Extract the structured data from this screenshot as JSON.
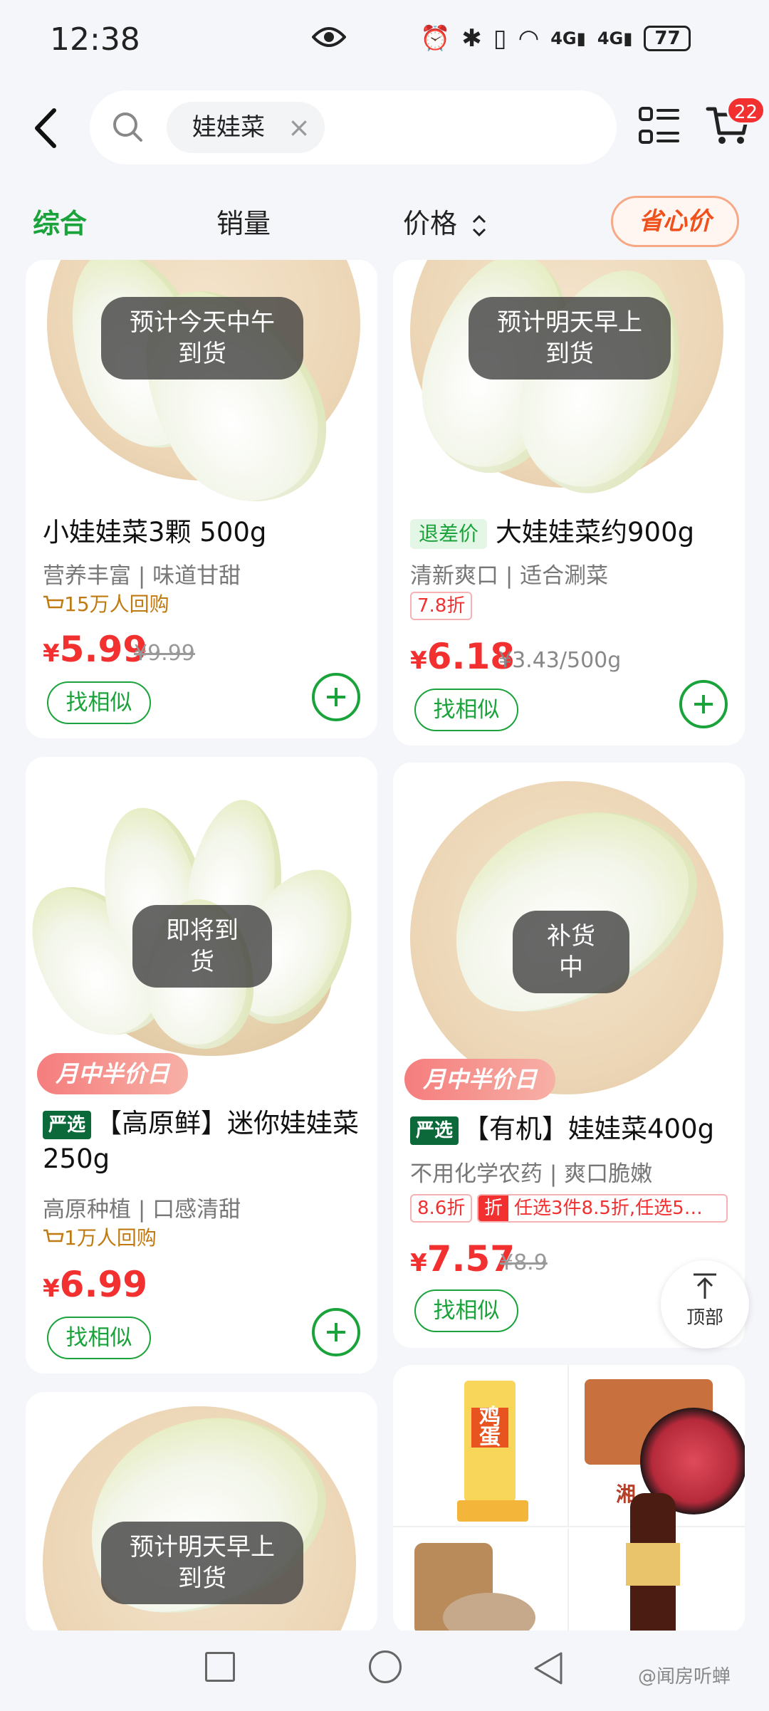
{
  "status_bar": {
    "time": "12:38",
    "battery": "77",
    "icons": [
      "eye-icon",
      "alarm-icon",
      "bluetooth-icon",
      "vibrate-icon",
      "wifi-icon",
      "signal-4g-icon",
      "signal-4g-icon"
    ]
  },
  "header": {
    "search_chip": "娃娃菜",
    "cart_badge": "22"
  },
  "sort_bar": {
    "comprehensive": "综合",
    "sales": "销量",
    "price": "价格",
    "saver_price": "省心价"
  },
  "products": [
    {
      "overlay": "预计今天中午\n到货",
      "title": "小娃娃菜3颗 500g",
      "subtitle": "营养丰富 | 味道甘甜",
      "repurchase": "15万人回购",
      "price_yen": "¥",
      "price": "5.99",
      "old_price": "¥9.99",
      "similar": "找相似"
    },
    {
      "overlay": "预计明天早上\n到货",
      "tag": "退差价",
      "title": "大娃娃菜约900g",
      "subtitle": "清新爽口 | 适合涮菜",
      "discount": "7.8折",
      "price_yen": "¥",
      "price": "6.18",
      "unit_price": "¥3.43/500g",
      "similar": "找相似"
    },
    {
      "overlay": "即将到货",
      "promo": "月中半价日",
      "tag": "严选",
      "title": "【高原鲜】迷你娃娃菜250g",
      "subtitle": "高原种植 | 口感清甜",
      "repurchase": "1万人回购",
      "price_yen": "¥",
      "price": "6.99",
      "similar": "找相似"
    },
    {
      "overlay": "补货中",
      "promo": "月中半价日",
      "tag": "严选",
      "title": "【有机】娃娃菜400g",
      "subtitle": "不用化学农药 | 爽口脆嫩",
      "discount": "8.6折",
      "promo_zhe": "折",
      "promo_line": "任选3件8.5折,任选5…",
      "price_yen": "¥",
      "price": "7.57",
      "old_price": "¥8.9",
      "similar": "找相似"
    },
    {
      "overlay": "预计明天早上\n到货"
    }
  ],
  "ad_card": {
    "texts": [
      "鸡蛋",
      "湘"
    ]
  },
  "top_button": "顶部",
  "watermark": "@闻房听蝉"
}
